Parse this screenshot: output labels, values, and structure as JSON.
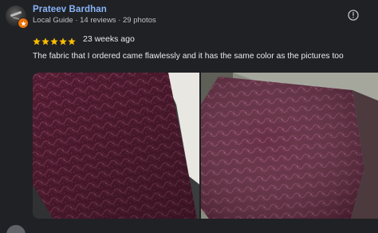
{
  "reviewer": {
    "name": "Prateev Bardhan",
    "meta": "Local Guide · 14 reviews · 29 photos"
  },
  "review": {
    "rating": 5,
    "date": "23 weeks ago",
    "text": "The fabric that I ordered came flawlessly and it has the same color as the pictures too"
  },
  "icons": {
    "star": "star-icon",
    "info": "more-info-icon",
    "badge": "local-guide-badge-icon"
  },
  "colors": {
    "background": "#202124",
    "name": "#8ab4f8",
    "star": "#fbbc04",
    "badge": "#e8710a",
    "fabric": "#5a1f35"
  }
}
